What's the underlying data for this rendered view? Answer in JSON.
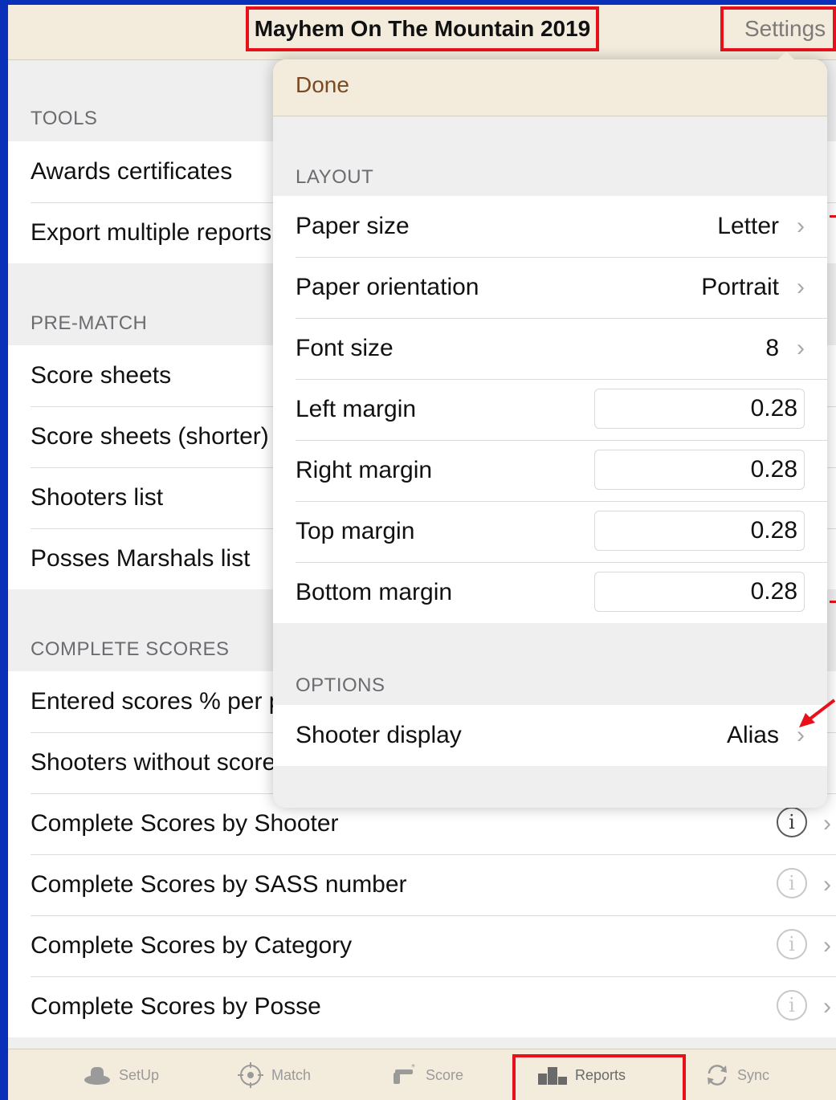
{
  "nav": {
    "title": "Mayhem On The Mountain 2019",
    "settings_label": "Settings"
  },
  "background": {
    "tools": {
      "header": "TOOLS",
      "items": [
        "Awards certificates",
        "Export multiple reports"
      ]
    },
    "prematch": {
      "header": "PRE-MATCH",
      "items": [
        "Score sheets",
        "Score sheets (shorter)",
        "Shooters list",
        "Posses Marshals list"
      ]
    },
    "complete": {
      "header": "COMPLETE SCORES",
      "items": [
        "Entered scores % per p",
        "Shooters without score",
        "Complete Scores by Shooter",
        "Complete Scores by SASS number",
        "Complete Scores by Category",
        "Complete Scores by Posse"
      ]
    }
  },
  "popover": {
    "done_label": "Done",
    "layout": {
      "header": "LAYOUT",
      "paper_size": {
        "label": "Paper size",
        "value": "Letter"
      },
      "paper_orientation": {
        "label": "Paper orientation",
        "value": "Portrait"
      },
      "font_size": {
        "label": "Font size",
        "value": "8"
      },
      "left_margin": {
        "label": "Left margin",
        "value": "0.28"
      },
      "right_margin": {
        "label": "Right margin",
        "value": "0.28"
      },
      "top_margin": {
        "label": "Top margin",
        "value": "0.28"
      },
      "bottom_margin": {
        "label": "Bottom margin",
        "value": "0.28"
      }
    },
    "options": {
      "header": "OPTIONS",
      "shooter_display": {
        "label": "Shooter display",
        "value": "Alias"
      }
    }
  },
  "tabbar": {
    "setup": "SetUp",
    "match": "Match",
    "score": "Score",
    "reports": "Reports",
    "sync": "Sync"
  },
  "icons": {
    "info": "i",
    "chevron": "›"
  },
  "colors": {
    "highlight": "#e8111b",
    "accent": "#7a4a22",
    "bar": "#f3ecdd"
  }
}
